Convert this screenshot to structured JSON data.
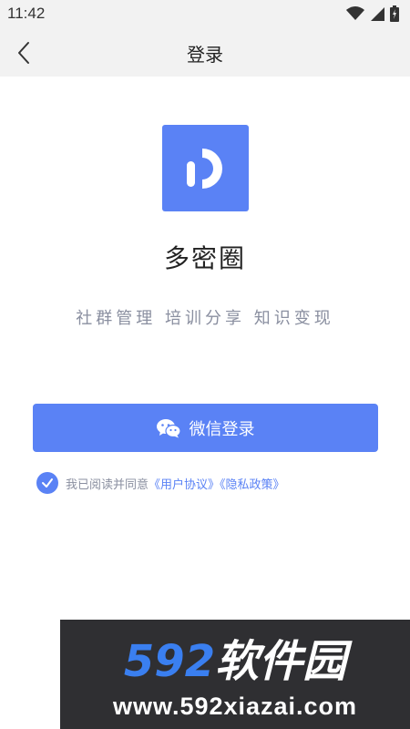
{
  "status_bar": {
    "time": "11:42"
  },
  "nav": {
    "title": "登录"
  },
  "app": {
    "name": "多密圈",
    "slogan": "社群管理 培训分享 知识变现"
  },
  "login": {
    "wechat_label": "微信登录"
  },
  "agreement": {
    "prefix": "我已阅读并同意",
    "user_agreement": "《用户协议》",
    "privacy_policy": "《隐私政策》"
  },
  "watermark": {
    "logo_text": "592软件园",
    "url": "www.592xiazai.com"
  },
  "colors": {
    "accent": "#5a82f5",
    "muted_text": "#8a8fa0",
    "bar_bg": "#f2f2f2",
    "watermark_bg": "#2f2f32"
  }
}
